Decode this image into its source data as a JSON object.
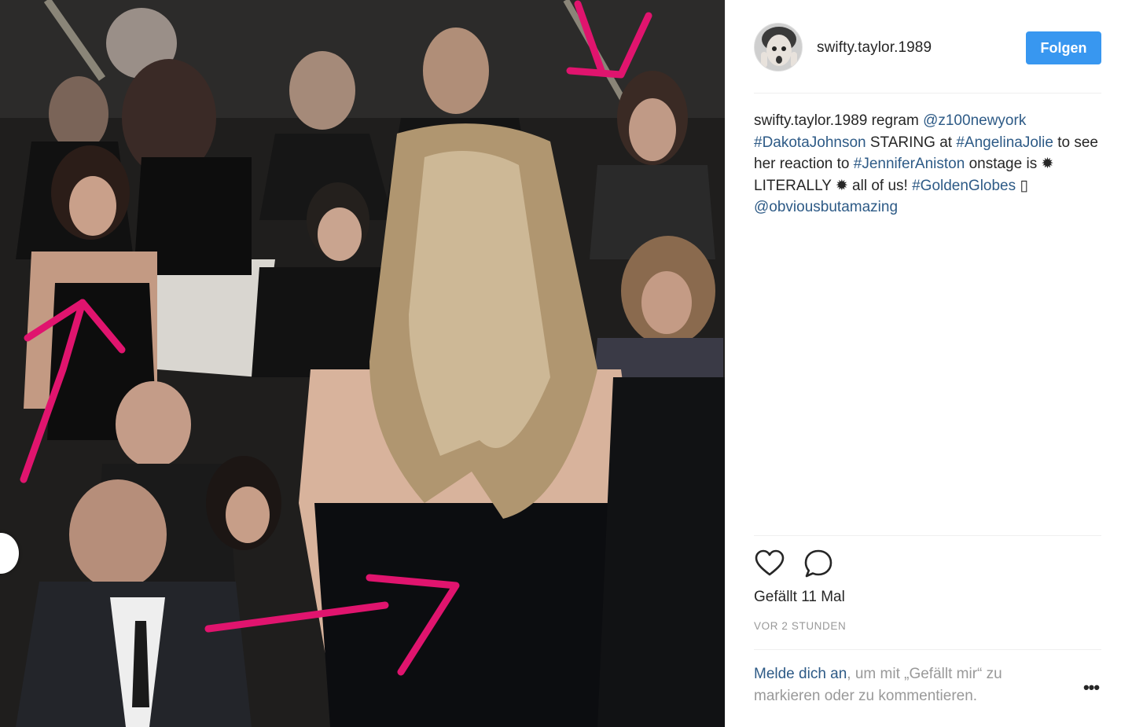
{
  "post": {
    "username": "swifty.taylor.1989",
    "follow_label": "Folgen",
    "caption": {
      "user": "swifty.taylor.1989",
      "t1": " regram ",
      "mention1": "@z100newyork",
      "hashtag1": "#DakotaJohnson",
      "t2": " STARING at ",
      "hashtag2": "#AngelinaJolie",
      "t3": " to see her reaction to ",
      "hashtag3": "#JenniferAniston",
      "t4": " onstage is ✹ LITERALLY ✹ all of us! ",
      "hashtag4": "#GoldenGlobes",
      "t5": " ▯ ",
      "mention2": "@obviousbutamazing"
    },
    "likes": "Gefällt 11 Mal",
    "time": "VOR 2 STUNDEN",
    "login": {
      "link": "Melde dich an",
      "rest": ", um mit „Gefällt mir“ zu markieren oder zu kommentieren."
    },
    "more_label": "•••"
  },
  "icons": {
    "like": "heart-icon",
    "comment": "comment-bubble-icon",
    "more": "more-options-icon"
  },
  "colors": {
    "follow_button": "#3897f0",
    "link": "#2d5a86",
    "muted": "#999999",
    "arrow": "#e0146e"
  }
}
